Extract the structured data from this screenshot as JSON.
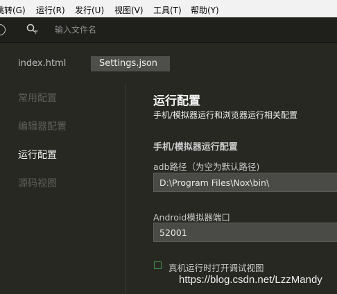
{
  "menubar": {
    "items": [
      "跳转(G)",
      "运行(R)",
      "发行(U)",
      "视图(V)",
      "工具(T)",
      "帮助(Y)"
    ]
  },
  "topbar": {
    "search_shortcut": "F",
    "search_placeholder": "输入文件名"
  },
  "tabs": [
    {
      "label": "index.html",
      "active": false
    },
    {
      "label": "Settings.json",
      "active": true
    }
  ],
  "sidebar": {
    "items": [
      {
        "label": "常用配置",
        "active": false
      },
      {
        "label": "编辑器配置",
        "active": false
      },
      {
        "label": "运行配置",
        "active": true
      },
      {
        "label": "源码视图",
        "active": false
      }
    ]
  },
  "main": {
    "title": "运行配置",
    "subtitle": "手机/模拟器运行和浏览器运行相关配置",
    "section_title": "手机/模拟器运行配置",
    "adb_label": "adb路径（为空为默认路径)",
    "adb_value": "D:\\Program Files\\Nox\\bin\\",
    "port_label": "Android模拟器端口",
    "port_value": "52001",
    "debug_checkbox_label": "真机运行时打开调试视图",
    "debug_checkbox_checked": false
  },
  "watermark": "https://blog.csdn.net/LzzMandy",
  "colors": {
    "background": "#272822",
    "topbar": "#1f201c",
    "active_tab": "#4e4f4a",
    "checkbox_border": "#3f8f4a"
  }
}
